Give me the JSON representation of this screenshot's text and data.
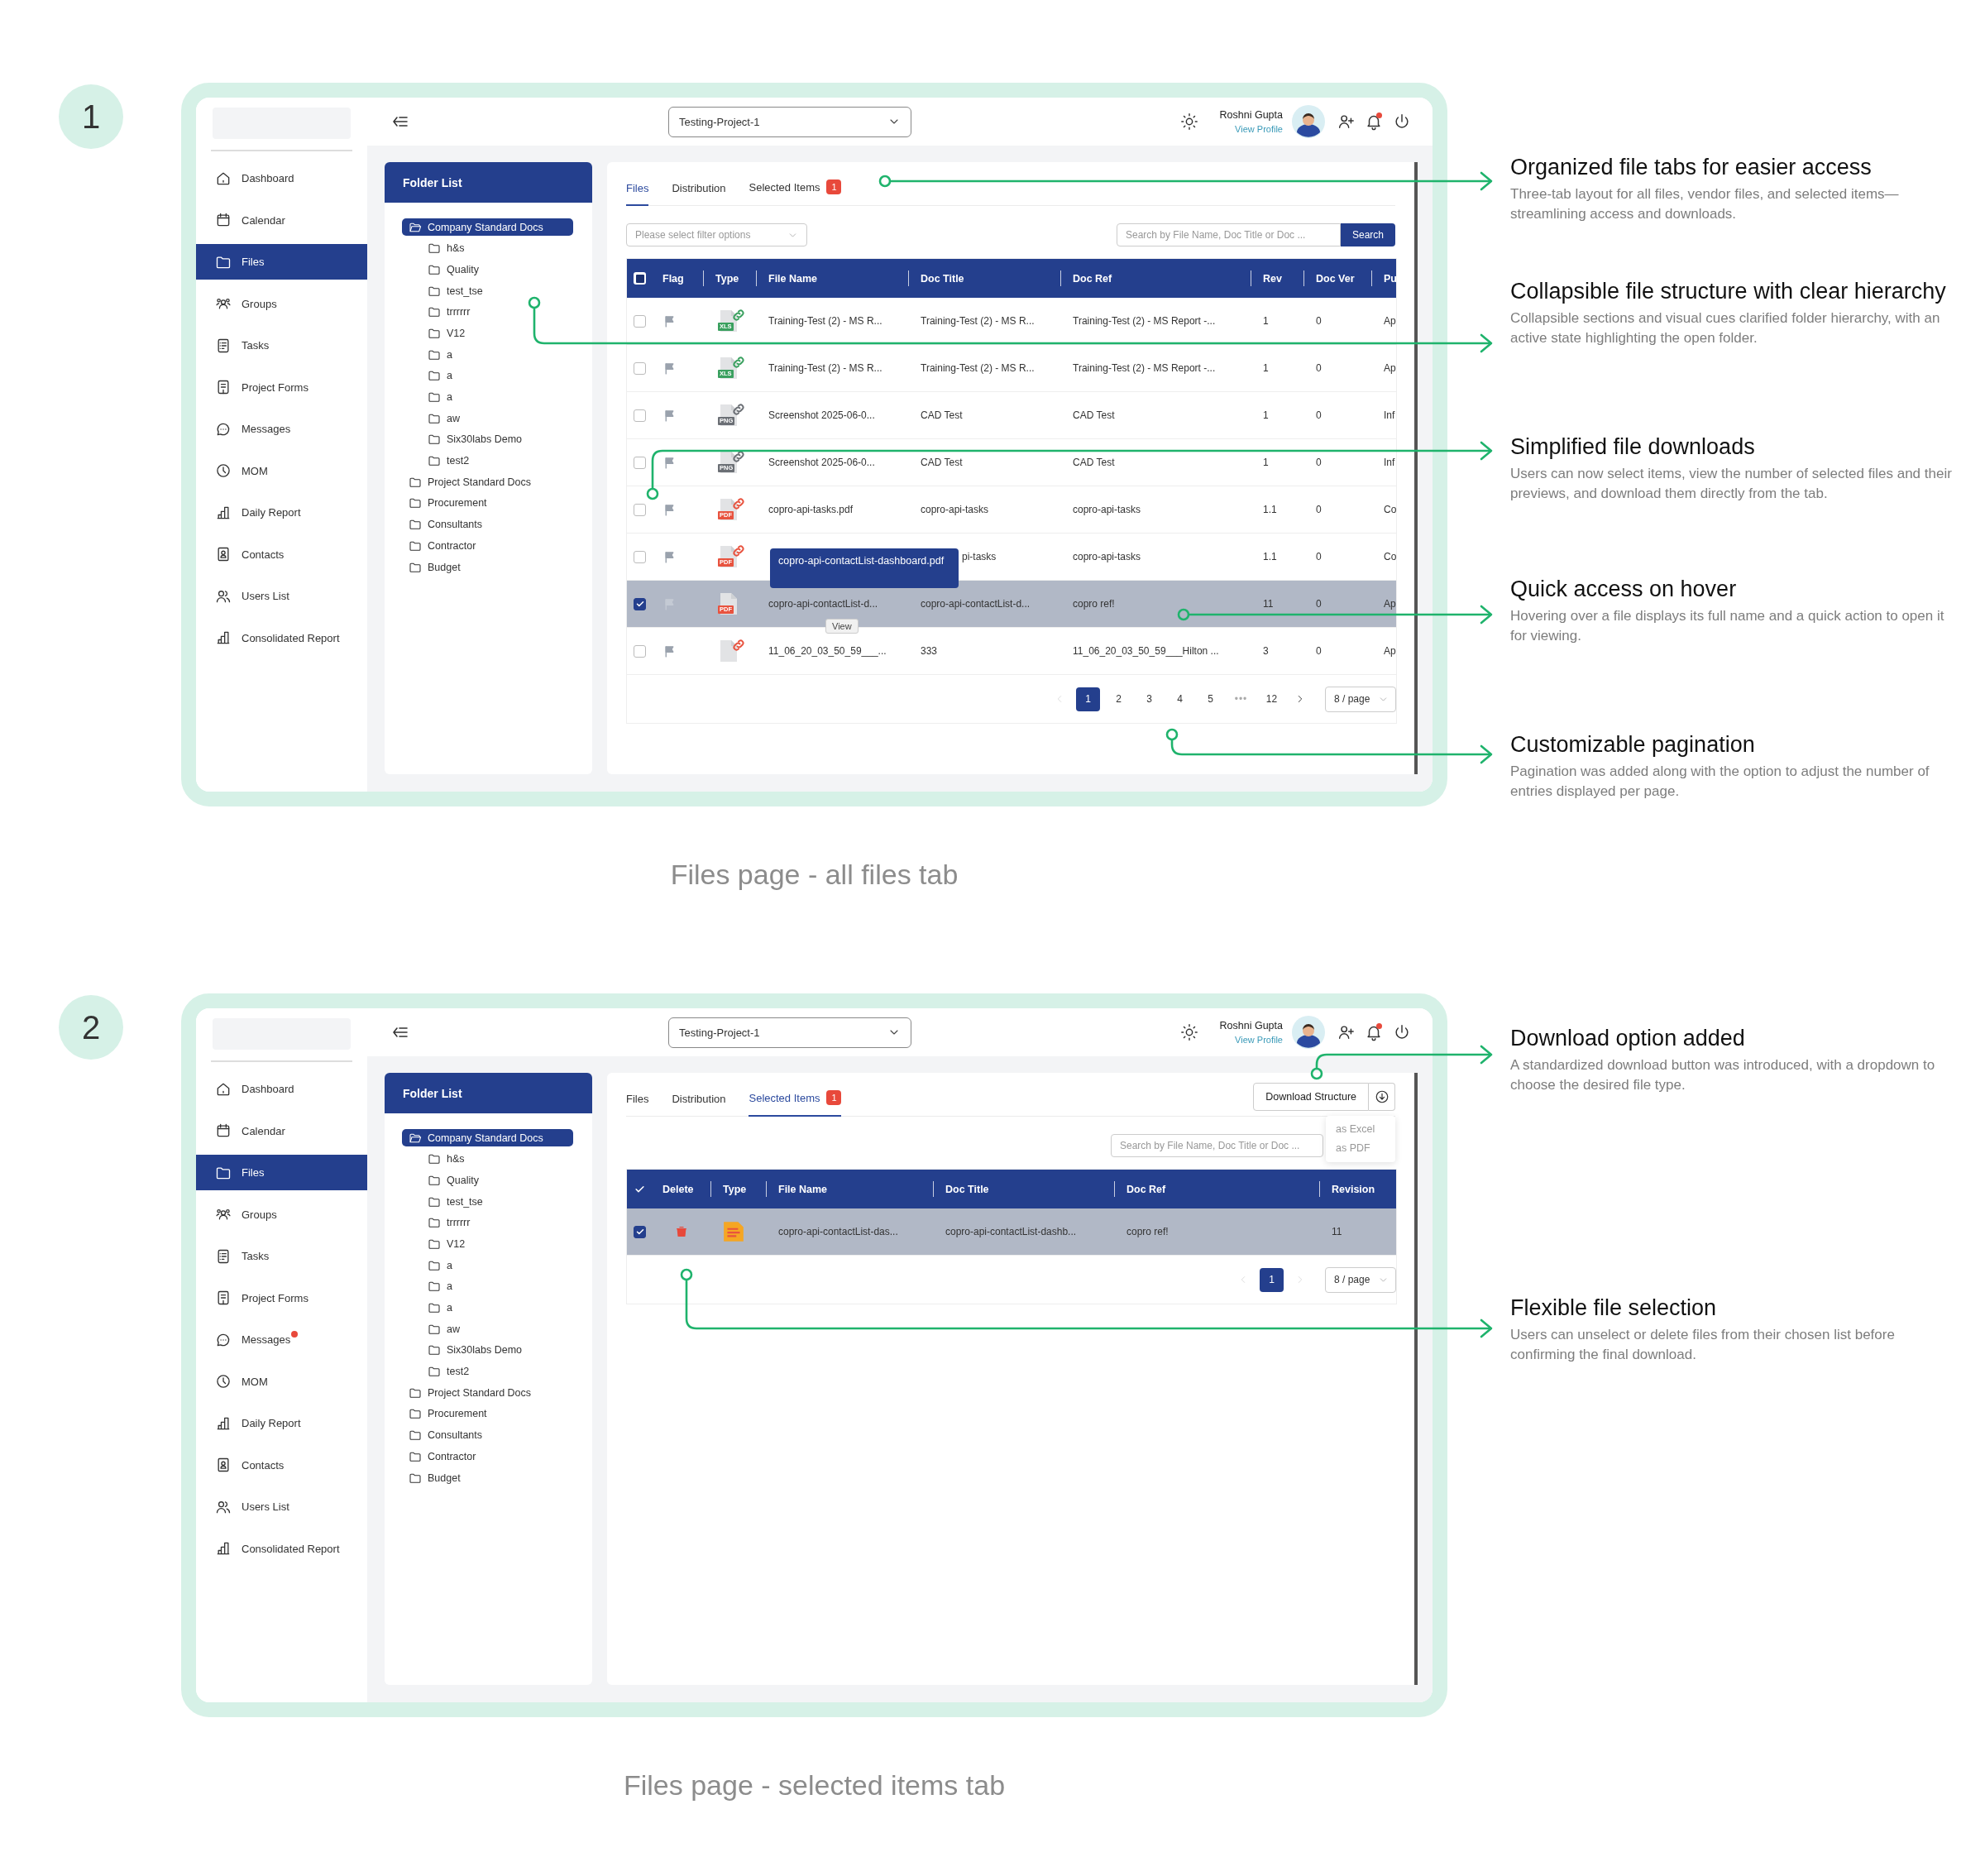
{
  "sections": [
    {
      "number": "1",
      "caption": "Files page - all files tab",
      "app": {
        "sidebar": {
          "items": [
            {
              "label": "Dashboard",
              "selected": false,
              "alert": false
            },
            {
              "label": "Calendar",
              "selected": false,
              "alert": false
            },
            {
              "label": "Files",
              "selected": true,
              "alert": false
            },
            {
              "label": "Groups",
              "selected": false,
              "alert": false
            },
            {
              "label": "Tasks",
              "selected": false,
              "alert": false
            },
            {
              "label": "Project Forms",
              "selected": false,
              "alert": false
            },
            {
              "label": "Messages",
              "selected": false,
              "alert": false
            },
            {
              "label": "MOM",
              "selected": false,
              "alert": false
            },
            {
              "label": "Daily Report",
              "selected": false,
              "alert": false
            },
            {
              "label": "Contacts",
              "selected": false,
              "alert": false
            },
            {
              "label": "Users List",
              "selected": false,
              "alert": false
            },
            {
              "label": "Consolidated Report",
              "selected": false,
              "alert": false
            }
          ]
        },
        "header": {
          "project": "Testing-Project-1",
          "user": "Roshni Gupta",
          "profile_link": "View Profile",
          "bell_alert": true
        },
        "folder_list": {
          "title": "Folder List",
          "folders": [
            {
              "label": "Company Standard Docs",
              "selected": true,
              "expanded": true,
              "children": [
                {
                  "label": "h&s",
                  "selected": false
                },
                {
                  "label": "Quality",
                  "selected": false
                },
                {
                  "label": "test_tse",
                  "selected": false
                },
                {
                  "label": "trrrrrr",
                  "selected": false
                },
                {
                  "label": "V12",
                  "selected": false
                },
                {
                  "label": "a",
                  "selected": false
                },
                {
                  "label": "a",
                  "selected": false
                },
                {
                  "label": "a",
                  "selected": false
                },
                {
                  "label": "aw",
                  "selected": false
                },
                {
                  "label": "Six30labs Demo",
                  "selected": false
                },
                {
                  "label": "test2",
                  "selected": false
                }
              ]
            },
            {
              "label": "Project Standard Docs",
              "selected": false,
              "expanded": false
            },
            {
              "label": "Procurement",
              "selected": false,
              "expanded": false
            },
            {
              "label": "Consultants",
              "selected": false,
              "expanded": false
            },
            {
              "label": "Contractor",
              "selected": false,
              "expanded": false
            },
            {
              "label": "Budget",
              "selected": false,
              "expanded": false
            }
          ]
        },
        "panel": {
          "tabs": [
            {
              "label": "Files",
              "selected": true
            },
            {
              "label": "Distribution",
              "selected": false
            },
            {
              "label": "Selected Items",
              "selected": false,
              "badge": "1"
            }
          ],
          "filter": {
            "placeholder": "Please select filter options"
          },
          "search": {
            "placeholder": "Search by File Name, Doc Title or Doc ...",
            "button": "Search"
          },
          "table": {
            "select_all": {
              "indeterminate": true
            },
            "columns": [
              {
                "label": "Flag",
                "kind": "flag"
              },
              {
                "label": "Type",
                "kind": "type"
              },
              {
                "label": "File Name",
                "kind": "text"
              },
              {
                "label": "Doc Title",
                "kind": "text"
              },
              {
                "label": "Doc Ref",
                "kind": "text"
              },
              {
                "label": "Rev",
                "kind": "text"
              },
              {
                "label": "Doc Ver",
                "kind": "text"
              },
              {
                "label": "Pu",
                "kind": "text"
              }
            ],
            "rows": [
              {
                "checked": false,
                "type": {
                  "kind": "file",
                  "label": "XLS",
                  "color": "#3aa05f",
                  "linked": true
                },
                "cells": [
                  "",
                  "",
                  "Training-Test (2) - MS R...",
                  "Training-Test (2) - MS R...",
                  "Training-Test (2) - MS Report -...",
                  "1",
                  "0",
                  "Ap"
                ]
              },
              {
                "checked": false,
                "type": {
                  "kind": "file",
                  "label": "XLS",
                  "color": "#3aa05f",
                  "linked": true
                },
                "cells": [
                  "",
                  "",
                  "Training-Test (2) - MS R...",
                  "Training-Test (2) - MS R...",
                  "Training-Test (2) - MS Report -...",
                  "1",
                  "0",
                  "Ap"
                ]
              },
              {
                "checked": false,
                "type": {
                  "kind": "file",
                  "label": "PNG",
                  "color": "#6b6f75",
                  "linked": true
                },
                "cells": [
                  "",
                  "",
                  "Screenshot 2025-06-0...",
                  "CAD Test",
                  "CAD Test",
                  "1",
                  "0",
                  "Inf"
                ]
              },
              {
                "checked": false,
                "type": {
                  "kind": "file",
                  "label": "PNG",
                  "color": "#6b6f75",
                  "linked": true
                },
                "cells": [
                  "",
                  "",
                  "Screenshot 2025-06-0...",
                  "CAD Test",
                  "CAD Test",
                  "1",
                  "0",
                  "Inf"
                ]
              },
              {
                "checked": false,
                "type": {
                  "kind": "file",
                  "label": "PDF",
                  "color": "#e8533f",
                  "linked": true
                },
                "cells": [
                  "",
                  "",
                  "copro-api-tasks.pdf",
                  "copro-api-tasks",
                  "copro-api-tasks",
                  "1.1",
                  "0",
                  "Co"
                ]
              },
              {
                "checked": false,
                "type": {
                  "kind": "file",
                  "label": "PDF",
                  "color": "#e8533f",
                  "linked": true
                },
                "cells": [
                  "",
                  "",
                  null,
                  "pi-tasks",
                  "copro-api-tasks",
                  "1.1",
                  "0",
                  "Co"
                ]
              },
              {
                "checked": true,
                "type": {
                  "kind": "file",
                  "label": "PDF",
                  "color": "#e8533f",
                  "linked": false
                },
                "cells": [
                  "",
                  "",
                  "copro-api-contactList-d...",
                  "copro-api-contactList-d...",
                  "copro ref!",
                  "11",
                  "0",
                  "Ap"
                ],
                "tooltip": "copro-api-contactList-dashboard.pdf",
                "hover_action": "View"
              },
              {
                "checked": false,
                "type": {
                  "kind": "file",
                  "color": "#e8533f",
                  "linked": true
                },
                "cells": [
                  "",
                  "",
                  "11_06_20_03_50_59___...",
                  "333",
                  "11_06_20_03_50_59___Hilton ...",
                  "3",
                  "0",
                  "Ap"
                ]
              }
            ]
          },
          "pagination": {
            "prev_disabled": true,
            "next_disabled": false,
            "pages": [
              {
                "label": "1",
                "selected": true,
                "kind": "page"
              },
              {
                "label": "2",
                "selected": false,
                "kind": "page"
              },
              {
                "label": "3",
                "selected": false,
                "kind": "page"
              },
              {
                "label": "4",
                "selected": false,
                "kind": "page"
              },
              {
                "label": "5",
                "selected": false,
                "kind": "page"
              },
              {
                "label": "•••",
                "selected": false,
                "kind": "ellipsis"
              },
              {
                "label": "12",
                "selected": false,
                "kind": "page"
              }
            ],
            "page_size": "8 / page"
          }
        }
      },
      "annotations": [
        {
          "title": "Organized file tabs for easier access",
          "text": "Three-tab layout for all files, vendor files, and selected items—streamlining access and downloads."
        },
        {
          "title": "Collapsible file structure with clear hierarchy",
          "text": "Collapsible sections and visual cues clarified folder hierarchy, with an active state highlighting the open folder."
        },
        {
          "title": "Simplified file downloads",
          "text": "Users can now select items, view the number of selected files and their previews, and download them directly from the tab."
        },
        {
          "title": "Quick access on hover",
          "text": "Hovering over a file displays its full name and a quick action to open it for viewing."
        },
        {
          "title": "Customizable pagination",
          "text": "Pagination was added along with the option to adjust the number of entries displayed per page."
        }
      ]
    },
    {
      "number": "2",
      "caption": "Files page - selected items tab",
      "app": {
        "sidebar": {
          "items": [
            {
              "label": "Dashboard",
              "selected": false,
              "alert": false
            },
            {
              "label": "Calendar",
              "selected": false,
              "alert": false
            },
            {
              "label": "Files",
              "selected": true,
              "alert": false
            },
            {
              "label": "Groups",
              "selected": false,
              "alert": false
            },
            {
              "label": "Tasks",
              "selected": false,
              "alert": false
            },
            {
              "label": "Project Forms",
              "selected": false,
              "alert": false
            },
            {
              "label": "Messages",
              "selected": false,
              "alert": true
            },
            {
              "label": "MOM",
              "selected": false,
              "alert": false
            },
            {
              "label": "Daily Report",
              "selected": false,
              "alert": false
            },
            {
              "label": "Contacts",
              "selected": false,
              "alert": false
            },
            {
              "label": "Users List",
              "selected": false,
              "alert": false
            },
            {
              "label": "Consolidated Report",
              "selected": false,
              "alert": false
            }
          ]
        },
        "header": {
          "project": "Testing-Project-1",
          "user": "Roshni Gupta",
          "profile_link": "View Profile",
          "bell_alert": true
        },
        "folder_list": {
          "title": "Folder List",
          "folders": [
            {
              "label": "Company Standard Docs",
              "selected": true,
              "expanded": true,
              "children": [
                {
                  "label": "h&s",
                  "selected": false
                },
                {
                  "label": "Quality",
                  "selected": false
                },
                {
                  "label": "test_tse",
                  "selected": false
                },
                {
                  "label": "trrrrrr",
                  "selected": false
                },
                {
                  "label": "V12",
                  "selected": false
                },
                {
                  "label": "a",
                  "selected": false
                },
                {
                  "label": "a",
                  "selected": false
                },
                {
                  "label": "a",
                  "selected": false
                },
                {
                  "label": "aw",
                  "selected": false
                },
                {
                  "label": "Six30labs Demo",
                  "selected": false
                },
                {
                  "label": "test2",
                  "selected": false
                }
              ]
            },
            {
              "label": "Project Standard Docs",
              "selected": false,
              "expanded": false
            },
            {
              "label": "Procurement",
              "selected": false,
              "expanded": false
            },
            {
              "label": "Consultants",
              "selected": false,
              "expanded": false
            },
            {
              "label": "Contractor",
              "selected": false,
              "expanded": false
            },
            {
              "label": "Budget",
              "selected": false,
              "expanded": false
            }
          ]
        },
        "panel": {
          "tabs": [
            {
              "label": "Files",
              "selected": false
            },
            {
              "label": "Distribution",
              "selected": false
            },
            {
              "label": "Selected Items",
              "selected": true,
              "badge": "1"
            }
          ],
          "download": {
            "label": "Download Structure",
            "menu": [
              "as Excel",
              "as PDF"
            ]
          },
          "search": {
            "placeholder": "Search by File Name, Doc Title or Doc ..."
          },
          "table": {
            "select_all": {
              "checked": true
            },
            "columns": [
              {
                "label": "Delete",
                "kind": "delete"
              },
              {
                "label": "Type",
                "kind": "type"
              },
              {
                "label": "File Name",
                "kind": "text"
              },
              {
                "label": "Doc Title",
                "kind": "text"
              },
              {
                "label": "Doc Ref",
                "kind": "text"
              },
              {
                "label": "Revision",
                "kind": "text"
              }
            ],
            "rows": [
              {
                "checked": true,
                "type": {
                  "kind": "document",
                  "color": "#f5a623"
                },
                "cells": [
                  "",
                  "",
                  "copro-api-contactList-das...",
                  "copro-api-contactList-dashb...",
                  "copro ref!",
                  "11"
                ]
              }
            ]
          },
          "pagination": {
            "prev_disabled": true,
            "next_disabled": true,
            "pages": [
              {
                "label": "1",
                "selected": true,
                "kind": "page"
              }
            ],
            "page_size": "8 / page"
          }
        }
      },
      "annotations": [
        {
          "title": "Download option added",
          "text": "A standardized download button was introduced, with a dropdown to choose the desired file type."
        },
        {
          "title": "Flexible file selection",
          "text": "Users can unselect or delete files from their chosen list before confirming the final download."
        }
      ]
    }
  ]
}
